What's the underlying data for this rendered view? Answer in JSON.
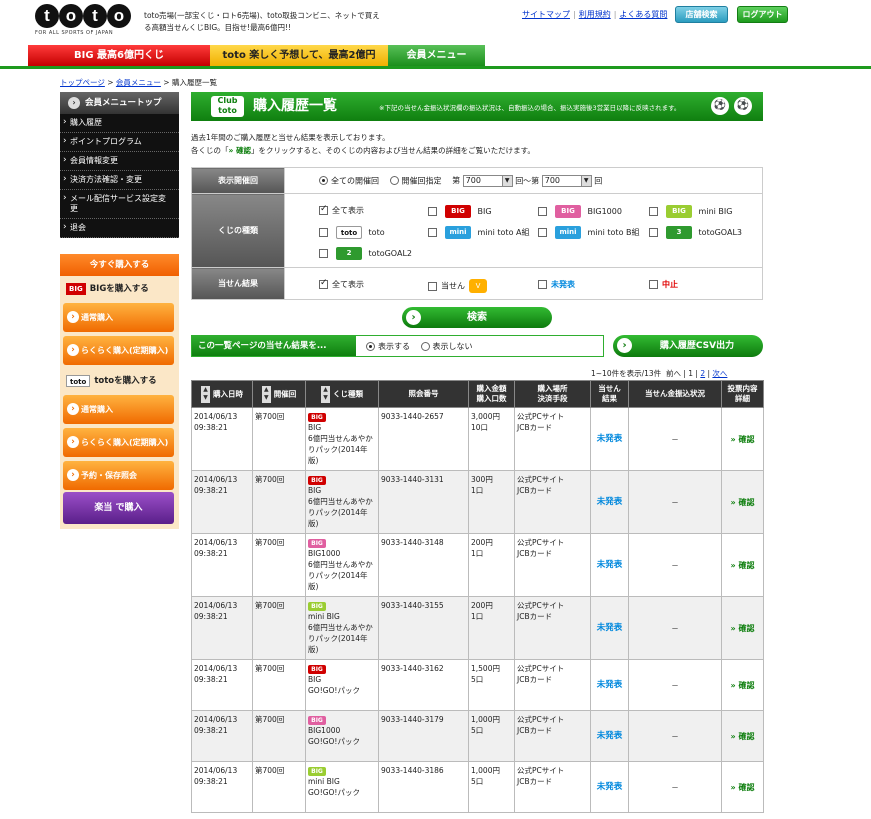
{
  "header": {
    "logo_text": "toto",
    "logo_sub": "FOR ALL SPORTS OF JAPAN",
    "tagline": "toto売場(一部宝くじ・ロト6売場)、toto取扱コンビニ、ネットで買える高額当せんくじBIG。目指せ!最高6億円!!",
    "links": [
      "サイトマップ",
      "利用規約",
      "よくある質問"
    ],
    "store_button": "店舗検索",
    "logout_button": "ログアウト"
  },
  "nav": {
    "big_tab": "BIG 最高6億円くじ",
    "toto_tab": "toto 楽しく予想して、最高2億円",
    "member_tab": "会員メニュー"
  },
  "breadcrumb": [
    "トップページ",
    "会員メニュー",
    "購入履歴一覧"
  ],
  "sidebar": {
    "head": "会員メニュートップ",
    "items": [
      "購入履歴",
      "ポイントプログラム",
      "会員情報変更",
      "決済方法確認・変更",
      "メール配信サービス設定変更",
      "退会"
    ],
    "buy_now": "今すぐ購入する",
    "big_section": "BIGを購入する",
    "big_logo": "BIG",
    "big_buttons": [
      "通常購入",
      "らくらく購入(定期購入)"
    ],
    "toto_section": "totoを購入する",
    "toto_logo": "toto",
    "toto_buttons": [
      "通常購入",
      "らくらく購入(定期購入)",
      "予約・保存照会"
    ],
    "rakuban": "楽当 で購入"
  },
  "main": {
    "club_label": "Club toto",
    "title": "購入履歴一覧",
    "title_note": "※下記の当せん金振込状況欄の振込状況は、自動振込の場合、振込実施後3営業日以降に反映されます。",
    "intro1": "過去1年間のご購入履歴と当せん結果を表示しております。",
    "intro2_a": "各くじの「",
    "intro2_key": "» 確認",
    "intro2_b": "」をクリックすると、そのくじの内容および当せん結果の詳細をご覧いただけます。"
  },
  "filters": {
    "round_label": "表示開催回",
    "round_all": "全ての開催回",
    "round_spec": "開催回指定",
    "round_pre": "第",
    "round_from": "700",
    "round_mid": "回～第",
    "round_to": "700",
    "round_post": "回",
    "type_label": "くじの種類",
    "type_all": "全て表示",
    "types": [
      "BIG",
      "BIG1000",
      "mini BIG",
      "toto",
      "mini toto A組",
      "mini toto B組",
      "totoGOAL3",
      "totoGOAL2"
    ],
    "result_label": "当せん結果",
    "result_all": "全て表示",
    "result_win": "当せん",
    "result_pending": "未発表",
    "result_cancel": "中止"
  },
  "search_button": "検索",
  "page_result": {
    "label": "この一覧ページの当せん結果を...",
    "show": "表示する",
    "hide": "表示しない"
  },
  "csv_button": "購入履歴CSV出力",
  "pagination": {
    "summary": "1~10件を表示/13件",
    "prev": "前へ",
    "p1": "1",
    "p2": "2",
    "next": "次へ"
  },
  "table": {
    "headers": [
      "購入日時",
      "開催回",
      "くじ種類",
      "照会番号",
      "購入金額\n購入口数",
      "購入場所\n決済手段",
      "当せん\n結果",
      "当せん金振込状況",
      "投票内容\n詳細"
    ],
    "rows": [
      {
        "date": "2014/06/13",
        "time": "09:38:21",
        "round": "第700回",
        "badge": "BIG",
        "kind": "BIG",
        "name": "6億円当せんあやかりパック(2014年版)",
        "ref": "9033-1440-2657",
        "amount": "3,000円",
        "units": "10口",
        "place": "公式PCサイト",
        "pay": "JCBカード",
        "result": "未発表",
        "transfer": "－",
        "detail": "» 確認"
      },
      {
        "date": "2014/06/13",
        "time": "09:38:21",
        "round": "第700回",
        "badge": "BIG",
        "kind": "BIG",
        "name": "6億円当せんあやかりパック(2014年版)",
        "ref": "9033-1440-3131",
        "amount": "300円",
        "units": "1口",
        "place": "公式PCサイト",
        "pay": "JCBカード",
        "result": "未発表",
        "transfer": "－",
        "detail": "» 確認"
      },
      {
        "date": "2014/06/13",
        "time": "09:38:21",
        "round": "第700回",
        "badge": "BIG",
        "kind": "BIG1000",
        "name": "6億円当せんあやかりパック(2014年版)",
        "ref": "9033-1440-3148",
        "amount": "200円",
        "units": "1口",
        "place": "公式PCサイト",
        "pay": "JCBカード",
        "result": "未発表",
        "transfer": "－",
        "detail": "» 確認"
      },
      {
        "date": "2014/06/13",
        "time": "09:38:21",
        "round": "第700回",
        "badge": "BIG",
        "kind": "mini BIG",
        "name": "6億円当せんあやかりパック(2014年版)",
        "ref": "9033-1440-3155",
        "amount": "200円",
        "units": "1口",
        "place": "公式PCサイト",
        "pay": "JCBカード",
        "result": "未発表",
        "transfer": "－",
        "detail": "» 確認"
      },
      {
        "date": "2014/06/13",
        "time": "09:38:21",
        "round": "第700回",
        "badge": "BIG",
        "kind": "BIG",
        "name": "GO!GO!パック",
        "ref": "9033-1440-3162",
        "amount": "1,500円",
        "units": "5口",
        "place": "公式PCサイト",
        "pay": "JCBカード",
        "result": "未発表",
        "transfer": "－",
        "detail": "» 確認"
      },
      {
        "date": "2014/06/13",
        "time": "09:38:21",
        "round": "第700回",
        "badge": "BIG",
        "kind": "BIG1000",
        "name": "GO!GO!パック",
        "ref": "9033-1440-3179",
        "amount": "1,000円",
        "units": "5口",
        "place": "公式PCサイト",
        "pay": "JCBカード",
        "result": "未発表",
        "transfer": "－",
        "detail": "» 確認"
      },
      {
        "date": "2014/06/13",
        "time": "09:38:21",
        "round": "第700回",
        "badge": "BIG",
        "kind": "mini BIG",
        "name": "GO!GO!パック",
        "ref": "9033-1440-3186",
        "amount": "1,000円",
        "units": "5口",
        "place": "公式PCサイト",
        "pay": "JCBカード",
        "result": "未発表",
        "transfer": "－",
        "detail": "» 確認"
      }
    ]
  },
  "colors": {
    "green": "#1e9a1e",
    "red": "#d00000",
    "orange": "#f06a00",
    "blue": "#0088dd"
  }
}
